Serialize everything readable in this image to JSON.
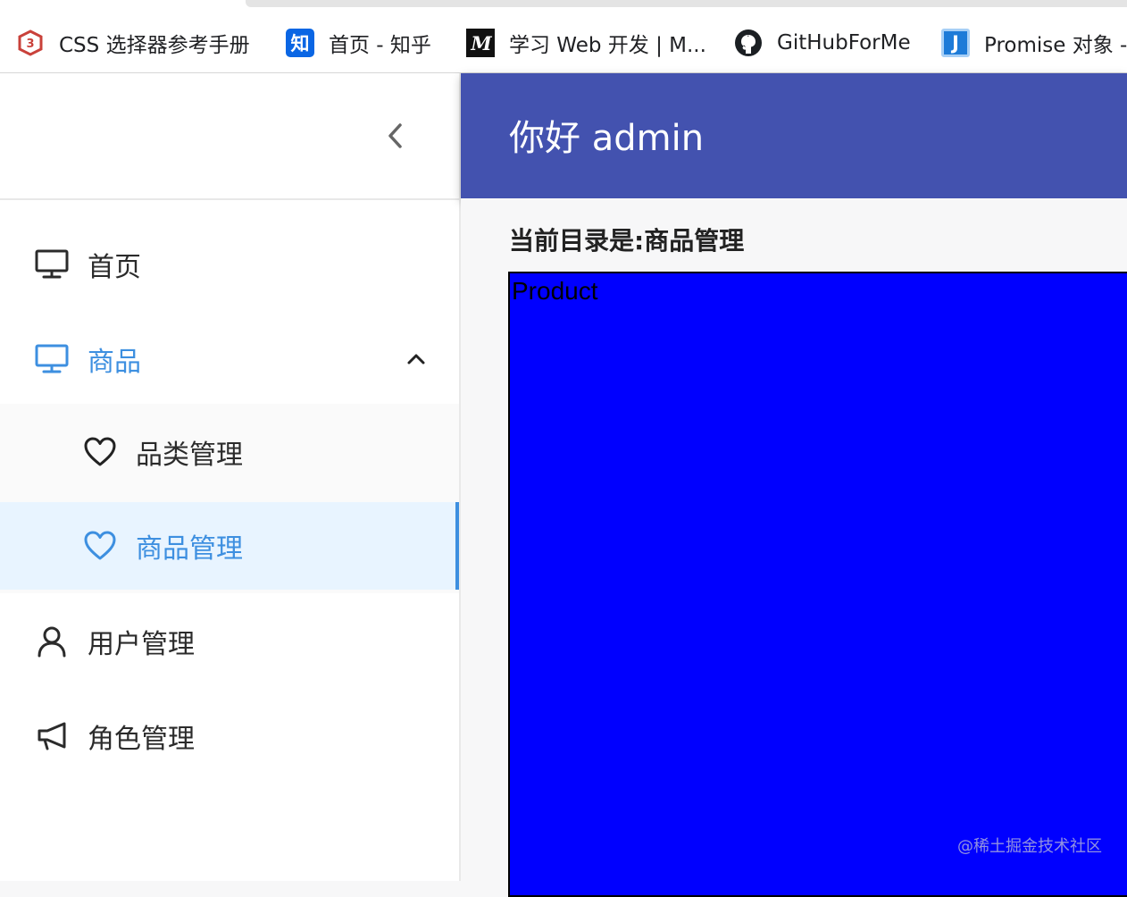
{
  "bookmarks": [
    {
      "label": "CSS 选择器参考手册",
      "icon": "w3-shield-icon"
    },
    {
      "label": "首页 - 知乎",
      "icon": "zhihu-icon",
      "icon_text": "知"
    },
    {
      "label": "学习 Web 开发 | M...",
      "icon": "mdn-icon",
      "icon_text": "M"
    },
    {
      "label": "GitHubForMe",
      "icon": "github-icon"
    },
    {
      "label": "Promise 对象 -",
      "icon": "j-icon",
      "icon_text": "J"
    }
  ],
  "header": {
    "title": "你好 admin",
    "bg_color": "#4352af"
  },
  "sidebar": {
    "items": [
      {
        "label": "首页",
        "icon": "desktop-icon"
      },
      {
        "label": "商品",
        "icon": "desktop-icon",
        "expanded": true,
        "children": [
          {
            "label": "品类管理",
            "icon": "heart-icon"
          },
          {
            "label": "商品管理",
            "icon": "heart-icon",
            "selected": true
          }
        ]
      },
      {
        "label": "用户管理",
        "icon": "user-icon"
      },
      {
        "label": "角色管理",
        "icon": "megaphone-icon"
      }
    ]
  },
  "content": {
    "breadcrumb": "当前目录是:商品管理",
    "product_text": "Product",
    "product_bg": "#0000ff",
    "watermark": "@稀土掘金技术社区"
  },
  "colors": {
    "accent": "#3d8fe0",
    "selected_bg": "#e8f4ff"
  }
}
